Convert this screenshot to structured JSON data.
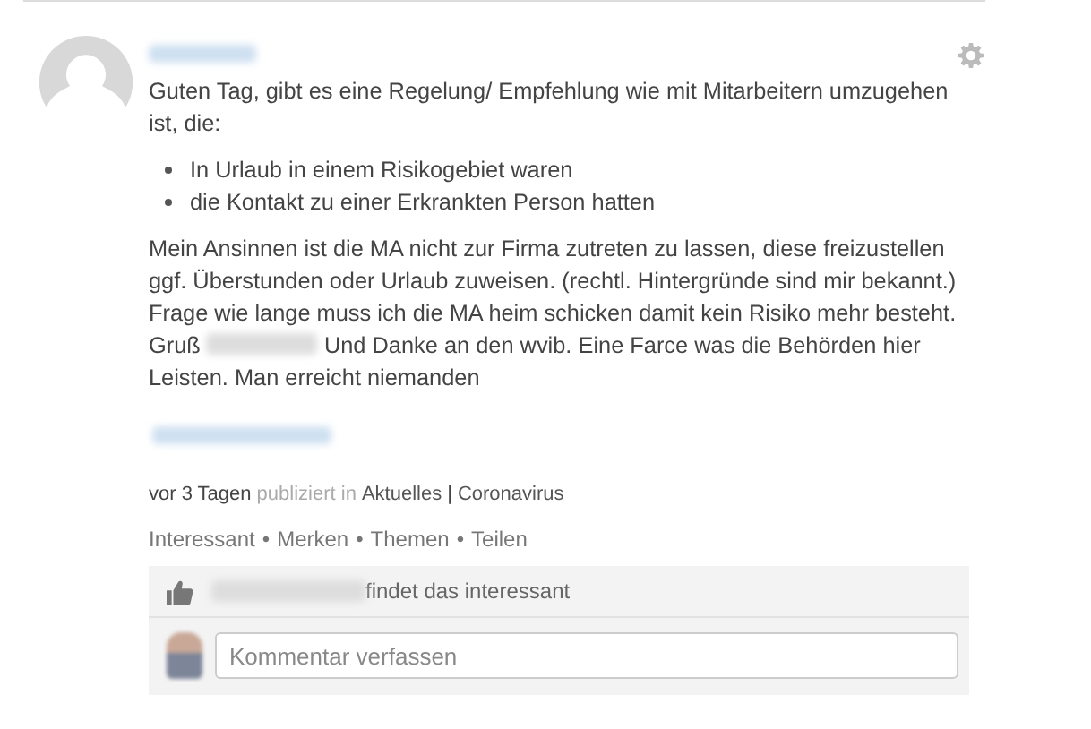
{
  "post": {
    "intro": "Guten Tag, gibt es eine Regelung/ Empfehlung wie mit Mitarbeitern umzugehen ist, die:",
    "bullets": [
      "In Urlaub in einem Risikogebiet waren",
      "die Kontakt zu einer Erkrankten Person hatten"
    ],
    "body_before_name": "Mein Ansinnen ist die MA nicht zur Firma zutreten zu lassen, diese freizustellen ggf. Überstunden oder Urlaub zuweisen. (rechtl. Hintergründe sind mir bekannt.) Frage wie lange muss ich die MA heim schicken damit kein Risiko mehr besteht. Gruß",
    "body_after_name": "Und Danke an den wvib. Eine Farce was die Behörden hier Leisten. Man erreicht niemanden"
  },
  "meta": {
    "age": "vor 3 Tagen",
    "published_in": "publiziert in",
    "categories": [
      {
        "label": "Aktuelles"
      },
      {
        "label": "Coronavirus"
      }
    ],
    "separator": "|"
  },
  "actions": [
    {
      "label": "Interessant"
    },
    {
      "label": "Merken"
    },
    {
      "label": "Themen"
    },
    {
      "label": "Teilen"
    }
  ],
  "action_separator": "•",
  "likes": {
    "text": "findet das interessant"
  },
  "comment": {
    "placeholder": "Kommentar verfassen"
  }
}
